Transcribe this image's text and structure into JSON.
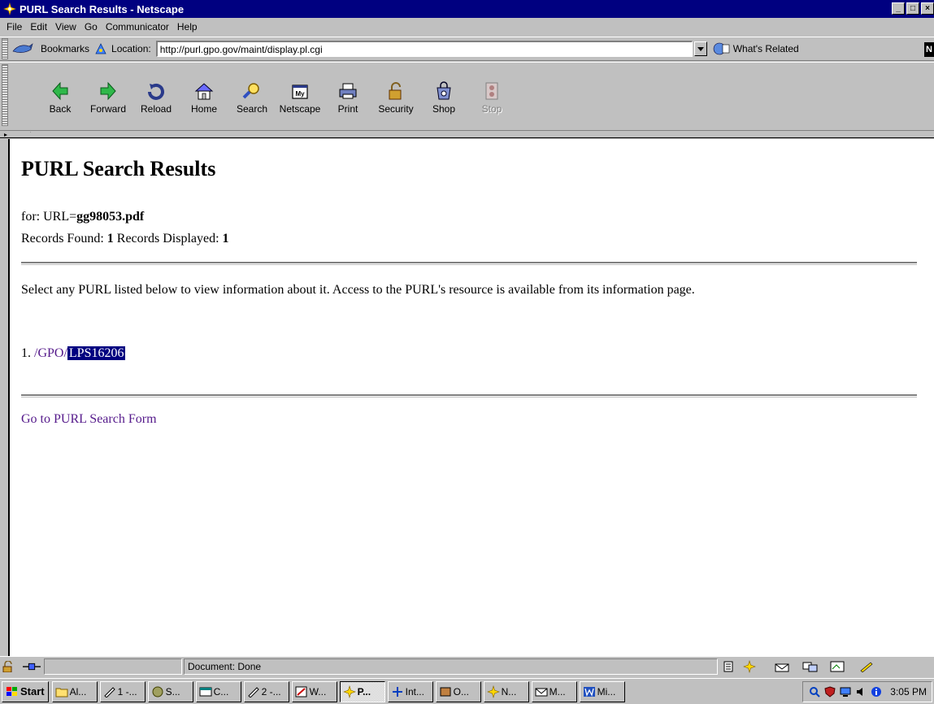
{
  "window": {
    "title": "PURL Search Results - Netscape",
    "controls": {
      "minimize": "_",
      "maximize": "□",
      "close": "×"
    }
  },
  "menu": [
    "File",
    "Edit",
    "View",
    "Go",
    "Communicator",
    "Help"
  ],
  "location_bar": {
    "bookmarks_label": "Bookmarks",
    "location_label": "Location:",
    "url": "http://purl.gpo.gov/maint/display.pl.cgi",
    "whats_related_label": "What's Related",
    "n_badge": "N"
  },
  "toolbar": [
    {
      "label": "Back",
      "icon": "back-arrow-icon",
      "enabled": true
    },
    {
      "label": "Forward",
      "icon": "forward-arrow-icon",
      "enabled": true
    },
    {
      "label": "Reload",
      "icon": "reload-icon",
      "enabled": true
    },
    {
      "label": "Home",
      "icon": "home-icon",
      "enabled": true
    },
    {
      "label": "Search",
      "icon": "search-icon",
      "enabled": true
    },
    {
      "label": "Netscape",
      "icon": "netscape-icon",
      "enabled": true
    },
    {
      "label": "Print",
      "icon": "printer-icon",
      "enabled": true
    },
    {
      "label": "Security",
      "icon": "lock-icon",
      "enabled": true
    },
    {
      "label": "Shop",
      "icon": "shop-icon",
      "enabled": true
    },
    {
      "label": "Stop",
      "icon": "stop-icon",
      "enabled": false
    }
  ],
  "page": {
    "heading": "PURL Search Results",
    "for_prefix": "for: URL=",
    "for_value": "gg98053.pdf",
    "records_found_label": "Records Found:",
    "records_found": "1",
    "records_displayed_label": "Records Displayed:",
    "records_displayed": "1",
    "intro": "Select any PURL listed below to view information about it. Access to the PURL's resource is available from its information page.",
    "result_number": "1.",
    "result_path": "/GPO/",
    "result_id": "LPS16206",
    "search_form_link": "Go to PURL Search Form"
  },
  "status_bar": {
    "message": "Document: Done"
  },
  "taskbar": {
    "start_label": "Start",
    "tasks": [
      {
        "label": "Al...",
        "icon": "folder-icon",
        "active": false
      },
      {
        "label": "1 -...",
        "icon": "pen-icon",
        "active": false
      },
      {
        "label": "S...",
        "icon": "program-icon",
        "active": false
      },
      {
        "label": "C...",
        "icon": "window-icon",
        "active": false
      },
      {
        "label": "2 -...",
        "icon": "pen-icon",
        "active": false
      },
      {
        "label": "W...",
        "icon": "editor-icon",
        "active": false
      },
      {
        "label": "P...",
        "icon": "netscape-icon",
        "active": true
      },
      {
        "label": "Int...",
        "icon": "network-icon",
        "active": false
      },
      {
        "label": "O...",
        "icon": "app-icon",
        "active": false
      },
      {
        "label": "N...",
        "icon": "netscape-icon",
        "active": false
      },
      {
        "label": "M...",
        "icon": "mail-icon",
        "active": false
      },
      {
        "label": "Mi...",
        "icon": "word-icon",
        "active": false
      }
    ],
    "clock": "3:05 PM"
  },
  "colors": {
    "titlebar": "#000080",
    "chrome": "#c0c0c0",
    "visited_link": "#551a8b",
    "selection": "#000080"
  }
}
